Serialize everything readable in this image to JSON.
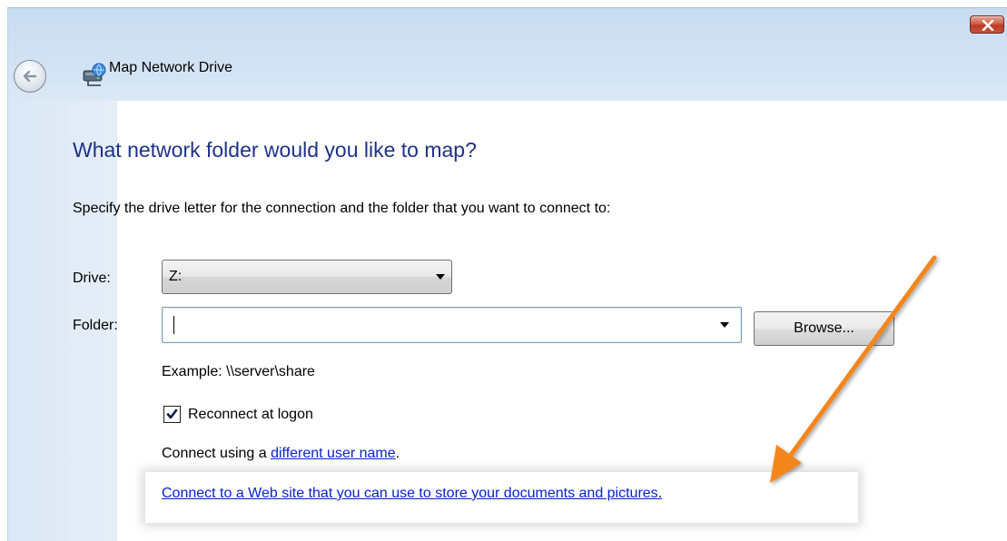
{
  "window": {
    "title": "Map Network Drive"
  },
  "icons": {
    "close": "close-icon",
    "back": "back-arrow-icon",
    "title": "network-drive-icon",
    "dropdown": "chevron-down-icon",
    "checkmark": "checkmark-icon",
    "annotation": "orange-arrow-annotation"
  },
  "main": {
    "heading": "What network folder would you like to map?",
    "instructions": "Specify the drive letter for the connection and the folder that you want to connect to:",
    "drive_label": "Drive:",
    "drive_value": "Z:",
    "folder_label": "Folder:",
    "folder_value": "",
    "browse_label": "Browse...",
    "example_text": "Example: \\\\server\\share",
    "reconnect_label": "Reconnect at logon",
    "reconnect_checked": true,
    "connect_prefix": "Connect using a ",
    "different_user_link": "different user name",
    "connect_suffix": ".",
    "web_site_link": "Connect to a Web site that you can use to store your documents and pictures",
    "web_site_suffix": "."
  },
  "colors": {
    "heading": "#1e3287",
    "link": "#0a22c8",
    "annotation_arrow": "#f5861f",
    "close_button": "#c8533b"
  }
}
